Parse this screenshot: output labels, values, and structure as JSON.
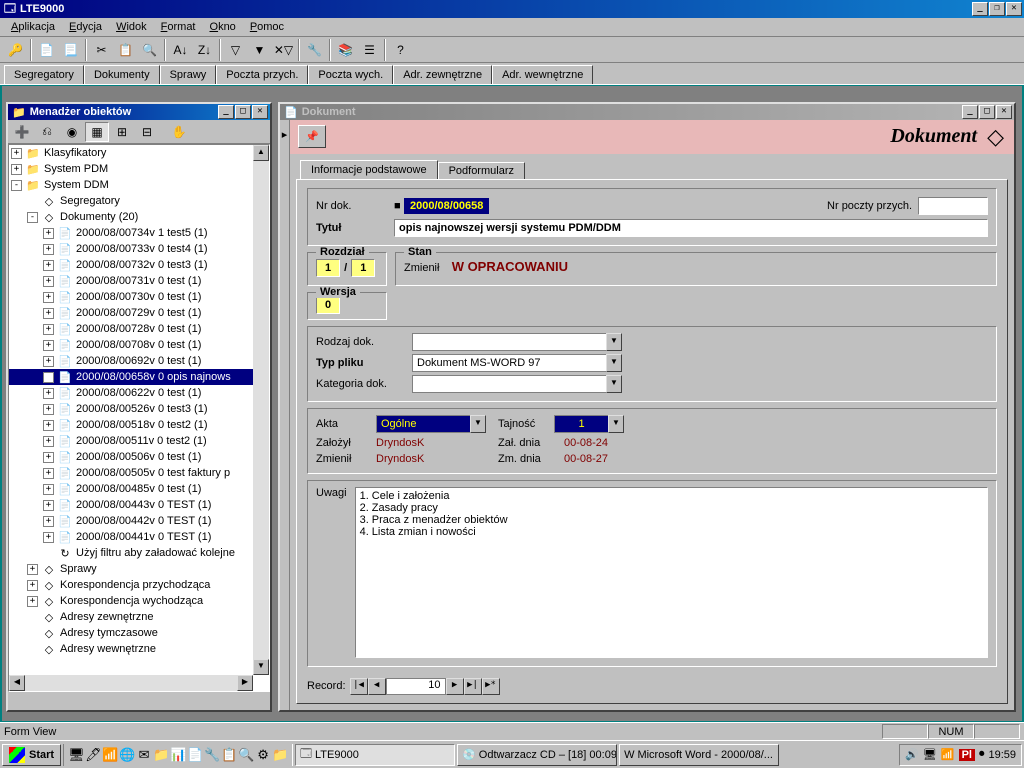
{
  "app": {
    "title": "LTE9000"
  },
  "menu": [
    "Aplikacja",
    "Edycja",
    "Widok",
    "Format",
    "Okno",
    "Pomoc"
  ],
  "tabs": [
    "Segregatory",
    "Dokumenty",
    "Sprawy",
    "Poczta przych.",
    "Poczta wych.",
    "Adr. zewnętrzne",
    "Adr. wewnętrzne"
  ],
  "obj_mgr": {
    "title": "Menadżer obiektów",
    "tree": [
      {
        "ind": 0,
        "exp": "+",
        "ico": "📁",
        "label": "Klasyfikatory"
      },
      {
        "ind": 0,
        "exp": "+",
        "ico": "📁",
        "label": "System PDM"
      },
      {
        "ind": 0,
        "exp": "-",
        "ico": "📁",
        "label": "System DDM"
      },
      {
        "ind": 1,
        "exp": "",
        "ico": "◇",
        "label": "Segregatory"
      },
      {
        "ind": 1,
        "exp": "-",
        "ico": "◇",
        "label": "Dokumenty (20)"
      },
      {
        "ind": 2,
        "exp": "+",
        "ico": "📄",
        "label": "2000/08/00734v 1 test5 (1)"
      },
      {
        "ind": 2,
        "exp": "+",
        "ico": "📄",
        "label": "2000/08/00733v 0 test4 (1)"
      },
      {
        "ind": 2,
        "exp": "+",
        "ico": "📄",
        "label": "2000/08/00732v 0 test3 (1)"
      },
      {
        "ind": 2,
        "exp": "+",
        "ico": "📄",
        "label": "2000/08/00731v 0 test (1)"
      },
      {
        "ind": 2,
        "exp": "+",
        "ico": "📄",
        "label": "2000/08/00730v 0 test (1)"
      },
      {
        "ind": 2,
        "exp": "+",
        "ico": "📄",
        "label": "2000/08/00729v 0 test (1)"
      },
      {
        "ind": 2,
        "exp": "+",
        "ico": "📄",
        "label": "2000/08/00728v 0 test (1)"
      },
      {
        "ind": 2,
        "exp": "+",
        "ico": "📄",
        "label": "2000/08/00708v 0 test (1)"
      },
      {
        "ind": 2,
        "exp": "+",
        "ico": "📄",
        "label": "2000/08/00692v 0 test (1)"
      },
      {
        "ind": 2,
        "exp": "+",
        "ico": "📄",
        "label": "2000/08/00658v 0 opis najnows",
        "sel": true
      },
      {
        "ind": 2,
        "exp": "+",
        "ico": "📄",
        "label": "2000/08/00622v 0 test (1)"
      },
      {
        "ind": 2,
        "exp": "+",
        "ico": "📄",
        "label": "2000/08/00526v 0 test3 (1)"
      },
      {
        "ind": 2,
        "exp": "+",
        "ico": "📄",
        "label": "2000/08/00518v 0 test2 (1)"
      },
      {
        "ind": 2,
        "exp": "+",
        "ico": "📄",
        "label": "2000/08/00511v 0 test2 (1)"
      },
      {
        "ind": 2,
        "exp": "+",
        "ico": "📄",
        "label": "2000/08/00506v 0 test (1)"
      },
      {
        "ind": 2,
        "exp": "+",
        "ico": "📄",
        "label": "2000/08/00505v 0 test faktury p"
      },
      {
        "ind": 2,
        "exp": "+",
        "ico": "📄",
        "label": "2000/08/00485v 0 test (1)"
      },
      {
        "ind": 2,
        "exp": "+",
        "ico": "📄",
        "label": "2000/08/00443v 0 TEST (1)"
      },
      {
        "ind": 2,
        "exp": "+",
        "ico": "📄",
        "label": "2000/08/00442v 0 TEST (1)"
      },
      {
        "ind": 2,
        "exp": "+",
        "ico": "📄",
        "label": "2000/08/00441v 0 TEST (1)"
      },
      {
        "ind": 2,
        "exp": "",
        "ico": "↻",
        "label": "Użyj filtru aby załadować kolejne"
      },
      {
        "ind": 1,
        "exp": "+",
        "ico": "◇",
        "label": "Sprawy"
      },
      {
        "ind": 1,
        "exp": "+",
        "ico": "◇",
        "label": "Korespondencja przychodząca"
      },
      {
        "ind": 1,
        "exp": "+",
        "ico": "◇",
        "label": "Korespondencja wychodząca"
      },
      {
        "ind": 1,
        "exp": "",
        "ico": "◇",
        "label": "Adresy zewnętrzne"
      },
      {
        "ind": 1,
        "exp": "",
        "ico": "◇",
        "label": "Adresy tymczasowe"
      },
      {
        "ind": 1,
        "exp": "",
        "ico": "◇",
        "label": "Adresy wewnętrzne"
      }
    ]
  },
  "doc": {
    "win_title": "Dokument",
    "header": "Dokument",
    "tabs": [
      "Informacje podstawowe",
      "Podformularz"
    ],
    "labels": {
      "nrdok": "Nr dok.",
      "nrpoczty": "Nr poczty przych.",
      "tytul": "Tytuł",
      "rozdzial": "Rozdział",
      "stan": "Stan",
      "zmienil": "Zmienił",
      "wopracowaniu": "W OPRACOWANIU",
      "wersja": "Wersja",
      "rodzaj": "Rodzaj dok.",
      "typ": "Typ pliku",
      "kategoria": "Kategoria dok.",
      "akta": "Akta",
      "tajnosc": "Tajność",
      "zalozyl": "Założył",
      "zaldnia": "Zał. dnia",
      "zmdnia": "Zm. dnia",
      "uwagi": "Uwagi",
      "record": "Record:"
    },
    "values": {
      "nrdok": "2000/08/00658",
      "tytul": "opis najnowszej wersji systemu PDM/DDM",
      "rozdzial1": "1",
      "rozdzial2": "1",
      "wersja": "0",
      "typ": "Dokument MS-WORD 97",
      "akta": "Ogólne",
      "tajnosc": "1",
      "zalozyl": "DryndosK",
      "zaldnia": "00-08-24",
      "zmienil": "DryndosK",
      "zmdnia": "00-08-27",
      "uwagi": "1. Cele i założenia\n2. Zasady pracy\n3. Praca z menadżer obiektów\n4. Lista zmian i nowości",
      "record": "10"
    }
  },
  "status": {
    "form_view": "Form View",
    "num": "NUM"
  },
  "taskbar": {
    "start": "Start",
    "tasks": [
      {
        "label": "LTE9000",
        "active": true,
        "ico": "🗔"
      },
      {
        "label": "Odtwarzacz CD – [18] 00:09",
        "active": false,
        "ico": "💿"
      },
      {
        "label": "Microsoft Word - 2000/08/...",
        "active": false,
        "ico": "W"
      }
    ],
    "clock": "19:59",
    "lang": "Pl"
  }
}
